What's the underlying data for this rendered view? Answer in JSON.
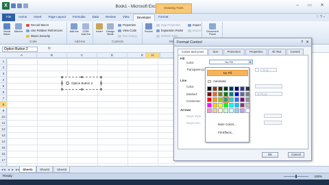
{
  "window": {
    "title": "Book1 - Microsoft Excel",
    "context_tab_group": "Drawing Tools",
    "app_icon": "X",
    "controls": [
      "–",
      "▭",
      "✕"
    ]
  },
  "ribbon_tabs": [
    "File",
    "Home",
    "Insert",
    "Page Layout",
    "Formulas",
    "Data",
    "Review",
    "View",
    "Developer",
    "Format"
  ],
  "ribbon_tabs_right": "♡ ? –",
  "ribbon": {
    "code": {
      "label": "Code",
      "visual_basic": "Visual Basic",
      "macros": "Macros",
      "record_macro": "Record Macro",
      "relative_refs": "Use Relative References",
      "macro_security": "Macro Security"
    },
    "addins": {
      "label": "Add-Ins",
      "add_ins": "Add-Ins",
      "com_add_ins": "COM Add-Ins"
    },
    "controls": {
      "label": "Controls",
      "insert": "Insert",
      "design_mode": "Design Mode",
      "properties": "Properties",
      "view_code": "View Code",
      "run_dialog": "Run Dialog"
    },
    "xml": {
      "label": "XML",
      "source": "Source",
      "map_properties": "Map Properties",
      "expansion_packs": "Expansion Packs",
      "refresh_data": "Refresh Data",
      "import": "Import",
      "export": "Export"
    },
    "modify": {
      "label": "Modify",
      "document_panel": "Document Panel"
    }
  },
  "formula_bar": {
    "name_box": "Option Button 2",
    "fx": "fx"
  },
  "grid": {
    "columns": [
      "A",
      "B",
      "C",
      "D",
      "E",
      "F",
      "G",
      "H"
    ],
    "active_column": "H",
    "rows": [
      "1",
      "2",
      "3",
      "4",
      "5",
      "6",
      "7",
      "8",
      "9",
      "10",
      "11",
      "12",
      "13",
      "14",
      "15",
      "16",
      "17"
    ],
    "active_row": "8",
    "option_button_label": "Option Button 2"
  },
  "sheets": [
    "Sheet1",
    "Sheet2",
    "Sheet3"
  ],
  "sheet_nav": "◂◂ ◂ ▸ ▸▸",
  "status": {
    "ready": "Ready",
    "zoom": "100%"
  },
  "dialog": {
    "title": "Format Control",
    "help": "?",
    "close": "✕",
    "tabs": [
      "Colors and Lines",
      "Size",
      "Protection",
      "Properties",
      "Alt Text",
      "Control"
    ],
    "active_tab": "Colors and Lines",
    "fill_section": "Fill",
    "color_label": "Color:",
    "transparency_label": "Transparency:",
    "transparency_value": "0 %",
    "line_section": "Line",
    "line_color_label": "Color:",
    "dashed_label": "Dashed:",
    "connector_label": "Connector:",
    "weight_value": "0.75 pt",
    "arrows_section": "Arrows",
    "begin_style_label": "Begin style:",
    "begin_size_label": "Begin size:",
    "combo_value": "No Fill",
    "ok": "OK",
    "cancel": "Cancel"
  },
  "color_dropdown": {
    "no_fill": "No Fill",
    "automatic": "Automatic",
    "more_colors": "More Colors...",
    "fill_effects": "Fill Effects...",
    "swatches": [
      "#000000",
      "#993300",
      "#333300",
      "#003300",
      "#003366",
      "#000080",
      "#333399",
      "#333333",
      "#800000",
      "#ff6600",
      "#808000",
      "#008000",
      "#008080",
      "#0000ff",
      "#666699",
      "#808080",
      "#ff0000",
      "#ff9900",
      "#99cc00",
      "#339966",
      "#33cccc",
      "#3366ff",
      "#800080",
      "#969696",
      "#ff00ff",
      "#ffcc00",
      "#ffff00",
      "#00ff00",
      "#00ffff",
      "#00ccff",
      "#993366",
      "#c0c0c0",
      "#ff99cc",
      "#ffcc99",
      "#ffff99",
      "#ccffcc",
      "#ccffff",
      "#99ccff",
      "#cc99ff",
      "#ffffff"
    ]
  },
  "colors": {
    "accent_orange": "#f6b35a",
    "file_tab": "#2a5fa6",
    "ribbon_bg": "#dbe6f4"
  }
}
